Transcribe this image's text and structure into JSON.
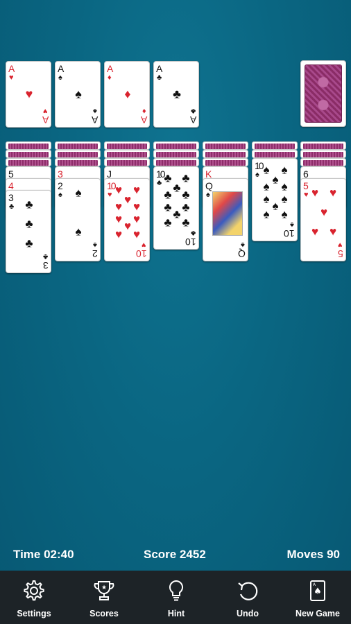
{
  "foundations": [
    {
      "rank": "A",
      "suit": "♥",
      "color": "red"
    },
    {
      "rank": "A",
      "suit": "♠",
      "color": "black"
    },
    {
      "rank": "A",
      "suit": "♦",
      "color": "red"
    },
    {
      "rank": "A",
      "suit": "♣",
      "color": "black"
    }
  ],
  "stock": {
    "card_back": "purple-pattern"
  },
  "tableau": [
    {
      "face_down": 3,
      "face_up": [
        {
          "rank": "5",
          "suit": "♠",
          "color": "black"
        },
        {
          "rank": "4",
          "suit": "♥",
          "color": "red"
        },
        {
          "rank": "3",
          "suit": "♣",
          "color": "black"
        }
      ]
    },
    {
      "face_down": 3,
      "face_up": [
        {
          "rank": "3",
          "suit": "♥",
          "color": "red"
        },
        {
          "rank": "2",
          "suit": "♠",
          "color": "black"
        }
      ]
    },
    {
      "face_down": 3,
      "face_up": [
        {
          "rank": "J",
          "suit": "♣",
          "color": "black"
        },
        {
          "rank": "10",
          "suit": "♥",
          "color": "red"
        }
      ]
    },
    {
      "face_down": 3,
      "face_up": [
        {
          "rank": "10",
          "suit": "♣",
          "color": "black"
        }
      ]
    },
    {
      "face_down": 3,
      "face_up": [
        {
          "rank": "K",
          "suit": "♥",
          "color": "red"
        },
        {
          "rank": "Q",
          "suit": "♠",
          "color": "black"
        }
      ]
    },
    {
      "face_down": 2,
      "face_up": [
        {
          "rank": "10",
          "suit": "♠",
          "color": "black"
        }
      ]
    },
    {
      "face_down": 3,
      "face_up": [
        {
          "rank": "6",
          "suit": "♠",
          "color": "black"
        },
        {
          "rank": "5",
          "suit": "♥",
          "color": "red"
        }
      ]
    }
  ],
  "status": {
    "time": "Time 02:40",
    "score": "Score 2452",
    "moves": "Moves 90"
  },
  "toolbar": [
    {
      "label": "Settings",
      "icon": "gear-icon"
    },
    {
      "label": "Scores",
      "icon": "trophy-icon"
    },
    {
      "label": "Hint",
      "icon": "lightbulb-icon"
    },
    {
      "label": "Undo",
      "icon": "undo-icon"
    },
    {
      "label": "New Game",
      "icon": "new-game-icon"
    }
  ],
  "colors": {
    "table": "#0a6682",
    "toolbar": "#1d2327",
    "red": "#d9232e",
    "black": "#111111"
  }
}
